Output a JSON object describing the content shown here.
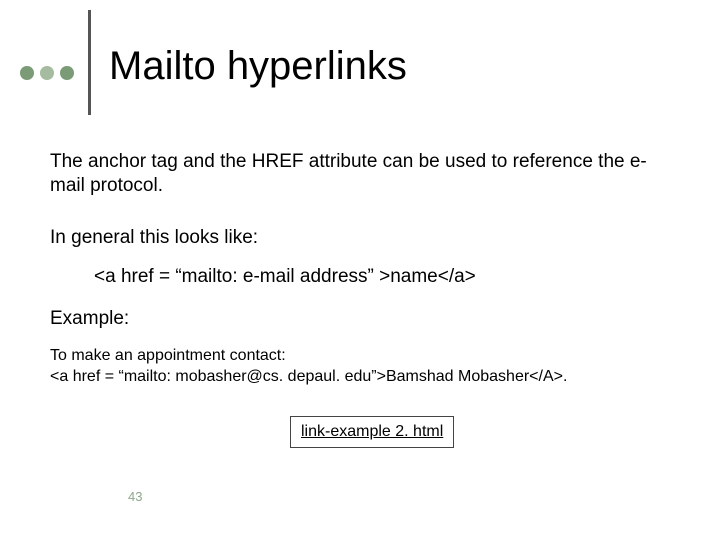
{
  "header": {
    "title": "Mailto hyperlinks"
  },
  "body": {
    "para1": "The anchor tag and the HREF attribute can be used to reference the e-mail protocol.",
    "para2": "In general this looks like:",
    "code": "<a href = “mailto: e-mail address” >name</a>",
    "example_label": "Example:",
    "example_line1": "To make an appointment contact:",
    "example_line2": "<a href = “mailto: mobasher@cs. depaul. edu”>Bamshad Mobasher</A>.",
    "link_label": "link-example 2. html"
  },
  "page_number": "43"
}
